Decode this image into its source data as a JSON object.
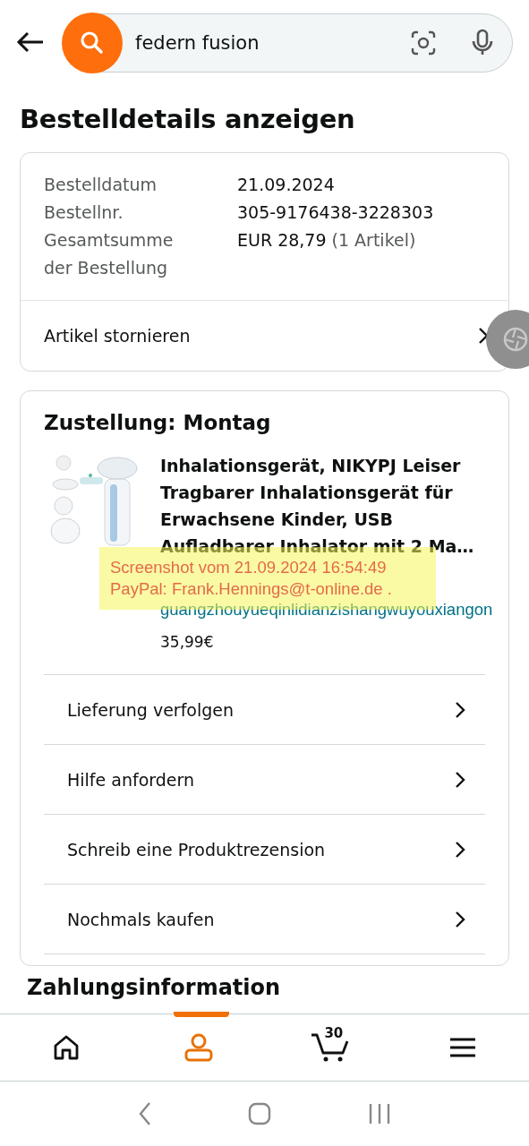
{
  "search": {
    "value": "federn fusion"
  },
  "title": "Bestelldetails anzeigen",
  "summary": {
    "rows": [
      {
        "label": "Bestelldatum",
        "value": "21.09.2024"
      },
      {
        "label": "Bestellnr.",
        "value": "305-9176438-3228303"
      },
      {
        "label": "Gesamtsumme der Bestellung",
        "value": "EUR 28,79",
        "note": "(1 Artikel)"
      }
    ],
    "action": "Artikel stornieren"
  },
  "delivery": {
    "heading": "Zustellung: Montag",
    "product": {
      "title": "Inhalationsgerät, NIKYPJ Leiser Tragbarer Inhalationsgerät für Erwachsene Kinder, USB Aufladbarer Inhalator mit 2 Ma…",
      "seller": "guangzhouyueqinlidianzishangwuyouxiangon",
      "price": "35,99€"
    },
    "actions": [
      "Lieferung verfolgen",
      "Hilfe anfordern",
      "Schreib eine Produktrezension",
      "Nochmals kaufen"
    ]
  },
  "next_section": "Zahlungsinformation",
  "note": {
    "lines": [
      "Screenshot vom 21.09.2024 16:54:49",
      "PayPal: Frank.Hennings@t-online.de ."
    ]
  },
  "bottom_nav": [
    {
      "kind": "home",
      "selected": false
    },
    {
      "kind": "account",
      "selected": true
    },
    {
      "kind": "cart",
      "selected": false,
      "badge": "30"
    },
    {
      "kind": "menu",
      "selected": false
    }
  ]
}
